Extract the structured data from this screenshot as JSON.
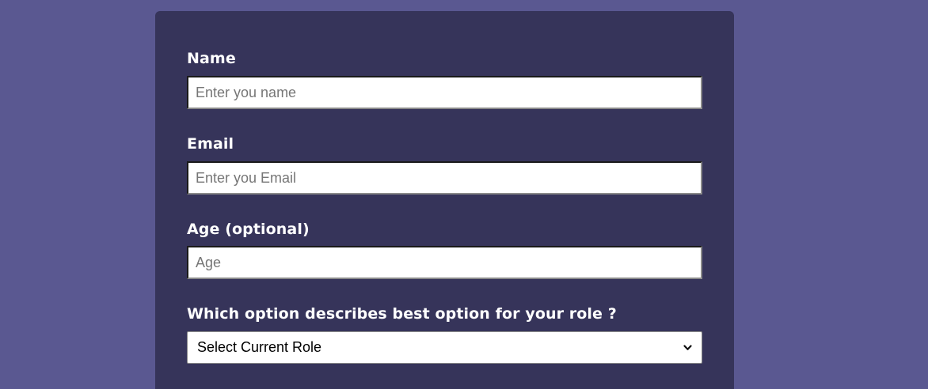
{
  "form": {
    "name": {
      "label": "Name",
      "placeholder": "Enter you name",
      "value": ""
    },
    "email": {
      "label": "Email",
      "placeholder": "Enter you Email",
      "value": ""
    },
    "age": {
      "label": "Age (optional)",
      "placeholder": "Age",
      "value": ""
    },
    "role": {
      "label": "Which option describes best option for your role ?",
      "selected": "Select Current Role",
      "icon": "chevron-down-icon"
    }
  },
  "colors": {
    "page_background": "#5a5891",
    "card_background": "#36345a",
    "label_text": "#ffffff",
    "input_background": "#ffffff"
  }
}
